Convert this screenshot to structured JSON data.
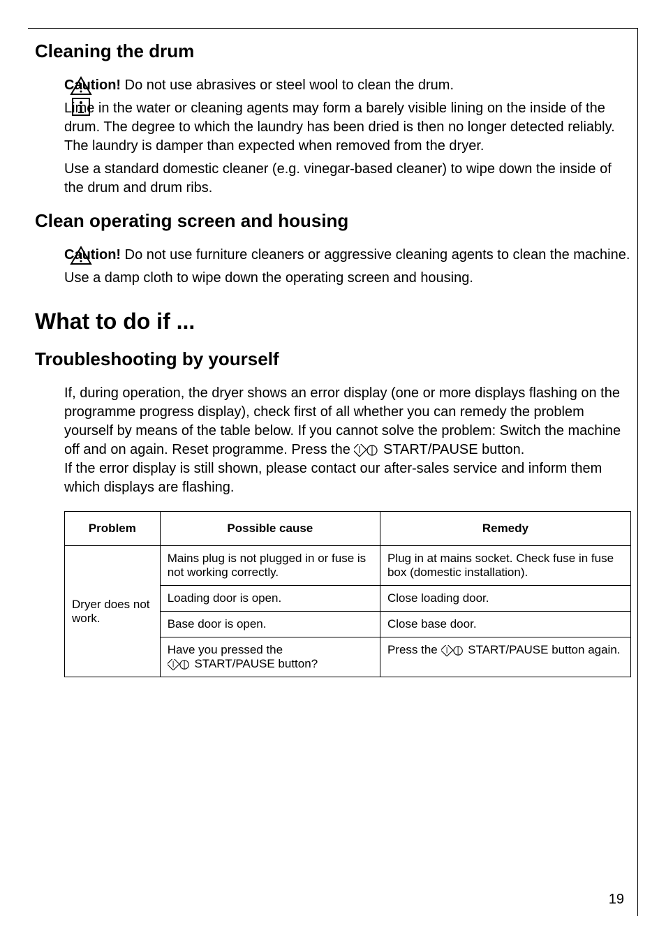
{
  "section1": {
    "heading": "Cleaning the drum",
    "caution_label": "Caution!",
    "caution_text": " Do not use abrasives or steel wool to clean the drum.",
    "info_para1": "Lime in the water or cleaning agents may form a barely visible lining on the inside of the drum. The degree to which the laundry has been dried is then no longer detected reliably. The laundry is damper than expected when removed from the dryer.",
    "info_para2": "Use a standard domestic cleaner (e.g. vinegar-based cleaner) to wipe down the inside of the drum and drum ribs."
  },
  "section2": {
    "heading": "Clean operating screen and housing",
    "caution_label": "Caution!",
    "caution_text": " Do not use furniture cleaners or aggressive cleaning agents to clean the machine.",
    "para1": "Use a damp cloth to wipe down the operating screen and housing."
  },
  "main_heading": "What to do if ...",
  "section3": {
    "heading": "Troubleshooting by yourself",
    "para_a": "If, during operation, the dryer shows an error display (one or more displays flashing on the programme progress display), check first of all whether you can remedy the problem yourself by means of the table below. If you cannot solve the problem: Switch the machine off and on again. Reset programme. Press the ",
    "para_a_btn": "START/PAUSE button.",
    "para_b": "If the error display is still shown, please contact our after-sales service and inform them which displays are flashing."
  },
  "table": {
    "headers": [
      "Problem",
      "Possible cause",
      "Remedy"
    ],
    "problem": "Dryer does not work.",
    "rows": [
      {
        "cause": "Mains plug is not plugged in or fuse is not working correctly.",
        "remedy": "Plug in at mains socket. Check fuse in fuse box (domestic installation)."
      },
      {
        "cause": "Loading door is open.",
        "remedy": "Close loading door."
      },
      {
        "cause": "Base door is open.",
        "remedy": "Close base door."
      },
      {
        "cause_a": "Have you pressed the ",
        "cause_b": "START/PAUSE button?",
        "remedy_a": "Press the ",
        "remedy_b": "START/PAUSE button again."
      }
    ]
  },
  "page_number": "19"
}
